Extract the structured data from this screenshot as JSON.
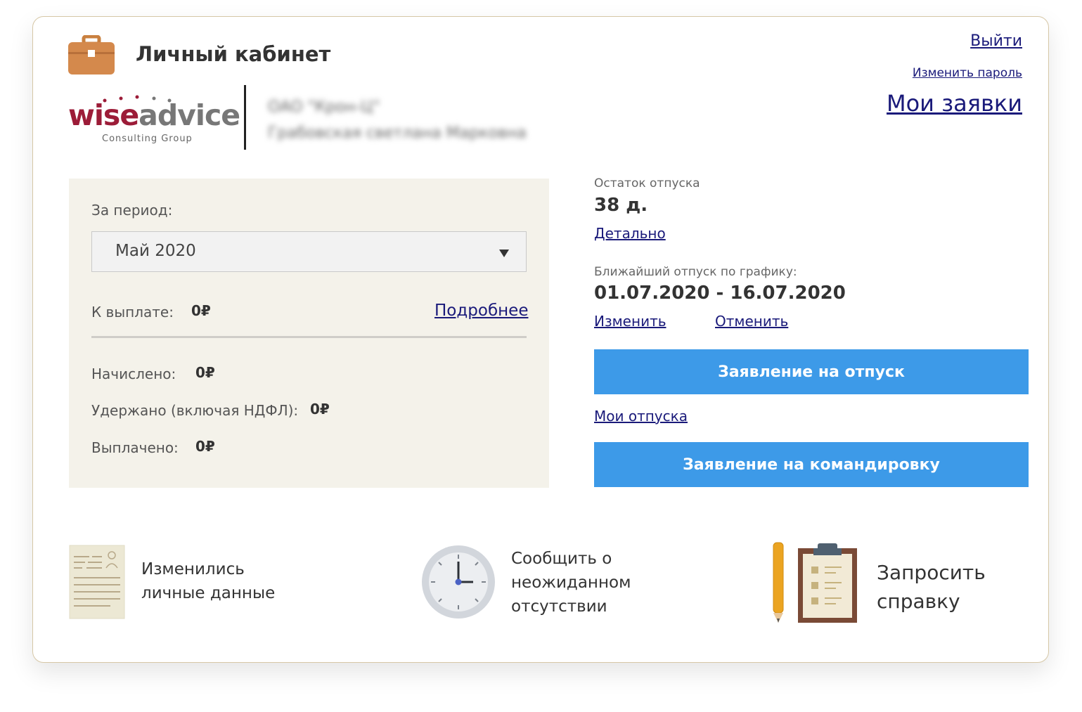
{
  "header": {
    "title": "Личный кабинет",
    "logout": "Выйти",
    "change_password": "Изменить пароль",
    "my_requests": "Мои заявки"
  },
  "logo": {
    "word_part1": "wise",
    "word_part2": "advice",
    "subtitle": "Consulting Group"
  },
  "company": {
    "name": "ОАО \"Крон-Ц\"",
    "person": "Грабовская светлана Марковна"
  },
  "pay": {
    "period_label": "За период:",
    "period_value": "Май 2020",
    "to_pay_label": "К выплате:",
    "to_pay_value": "0₽",
    "more_link": "Подробнее",
    "accrued_label": "Начислено:",
    "accrued_value": "0₽",
    "withheld_label": "Удержано (включая НДФЛ):",
    "withheld_value": "0₽",
    "paid_label": "Выплачено:",
    "paid_value": "0₽"
  },
  "vacation": {
    "balance_label": "Остаток отпуска",
    "balance_value": "38 д.",
    "detail_link": "Детально",
    "next_label": "Ближайший отпуск по графику:",
    "next_value": "01.07.2020 - 16.07.2020",
    "change_link": "Изменить",
    "cancel_link": "Отменить",
    "vacation_button": "Заявление на отпуск",
    "my_vacations_link": "Мои отпуска",
    "trip_button": "Заявление на командировку"
  },
  "tiles": [
    {
      "line1": "Изменились",
      "line2": "личные данные",
      "icon": "document-person-icon"
    },
    {
      "line1": "Сообщить о",
      "line2": "неожиданном",
      "line3": "отсутствии",
      "icon": "clock-icon"
    },
    {
      "line1": "Запросить",
      "line2": "справку",
      "icon": "clipboard-pencil-icon"
    }
  ],
  "colors": {
    "accent_button": "#3d9ae8",
    "panel_bg": "#f4f2ea",
    "logo_red": "#9c1c38",
    "briefcase": "#d4894c",
    "link": "#1a1a7a"
  }
}
